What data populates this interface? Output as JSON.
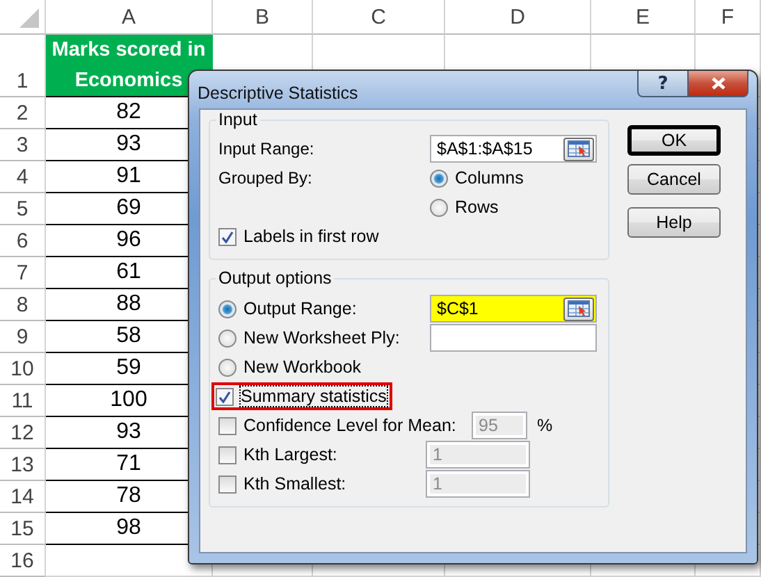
{
  "sheet": {
    "columns": [
      "A",
      "B",
      "C",
      "D",
      "E",
      "F"
    ],
    "rows": [
      {
        "number": "1",
        "value": "Marks scored in Economics",
        "kind": "header"
      },
      {
        "number": "2",
        "value": "82",
        "kind": "value"
      },
      {
        "number": "3",
        "value": "93",
        "kind": "value"
      },
      {
        "number": "4",
        "value": "91",
        "kind": "value"
      },
      {
        "number": "5",
        "value": "69",
        "kind": "value"
      },
      {
        "number": "6",
        "value": "96",
        "kind": "value"
      },
      {
        "number": "7",
        "value": "61",
        "kind": "value"
      },
      {
        "number": "8",
        "value": "88",
        "kind": "value"
      },
      {
        "number": "9",
        "value": "58",
        "kind": "value"
      },
      {
        "number": "10",
        "value": "59",
        "kind": "value"
      },
      {
        "number": "11",
        "value": "100",
        "kind": "value"
      },
      {
        "number": "12",
        "value": "93",
        "kind": "value"
      },
      {
        "number": "13",
        "value": "71",
        "kind": "value"
      },
      {
        "number": "14",
        "value": "78",
        "kind": "value"
      },
      {
        "number": "15",
        "value": "98",
        "kind": "value"
      },
      {
        "number": "16",
        "kind": "empty"
      }
    ]
  },
  "dialog": {
    "title": "Descriptive Statistics",
    "title_buttons": [
      {
        "kind": "help",
        "label": "?"
      },
      {
        "kind": "close"
      }
    ],
    "input_group": {
      "title": "Input",
      "input_range": {
        "label": "Input Range:",
        "value": "$A$1:$A$15"
      },
      "grouped_by": {
        "label": "Grouped By:",
        "options": [
          {
            "label": "Columns",
            "selected": true
          },
          {
            "label": "Rows",
            "selected": false
          }
        ]
      },
      "labels_in_first_row": {
        "label": "Labels in first row",
        "checked": true
      }
    },
    "output_group": {
      "title": "Output options",
      "items": [
        {
          "kind": "radio_range",
          "label": "Output Range:",
          "selected": true,
          "value": "$C$1",
          "highlighted": true,
          "picker": true
        },
        {
          "kind": "radio_range",
          "label": "New Worksheet Ply:",
          "selected": false,
          "highlighted": false,
          "picker": false
        },
        {
          "kind": "radio",
          "label": "New Workbook",
          "selected": false
        },
        {
          "kind": "checkbox",
          "label": "Summary statistics",
          "checked": true,
          "outlined": true,
          "focused": true
        },
        {
          "kind": "checkbox_value",
          "label": "Confidence Level for Mean:",
          "checked": false,
          "value": "95",
          "unit": "%",
          "field_disabled": true
        },
        {
          "kind": "checkbox_value",
          "label": "Kth Largest:",
          "checked": false,
          "value": "1",
          "field_disabled": true
        },
        {
          "kind": "checkbox_value",
          "label": "Kth Smallest:",
          "checked": false,
          "value": "1",
          "field_disabled": true
        }
      ]
    },
    "buttons": [
      {
        "label": "OK",
        "default": true
      },
      {
        "label": "Cancel",
        "default": false
      },
      {
        "label": "Help",
        "default": false
      }
    ]
  }
}
